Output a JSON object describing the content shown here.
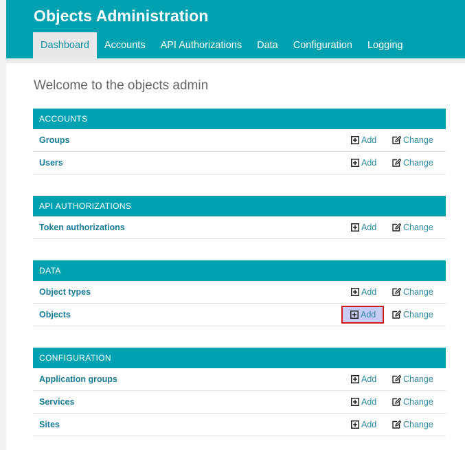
{
  "header": {
    "title": "Objects Administration",
    "nav": [
      {
        "label": "Dashboard",
        "active": true
      },
      {
        "label": "Accounts",
        "active": false
      },
      {
        "label": "API Authorizations",
        "active": false
      },
      {
        "label": "Data",
        "active": false
      },
      {
        "label": "Configuration",
        "active": false
      },
      {
        "label": "Logging",
        "active": false
      }
    ]
  },
  "welcome": "Welcome to the objects admin",
  "actions": {
    "add_label": "Add",
    "change_label": "Change"
  },
  "modules": [
    {
      "title": "ACCOUNTS",
      "rows": [
        {
          "name": "Groups"
        },
        {
          "name": "Users"
        }
      ]
    },
    {
      "title": "API AUTHORIZATIONS",
      "rows": [
        {
          "name": "Token authorizations"
        }
      ]
    },
    {
      "title": "DATA",
      "rows": [
        {
          "name": "Object types"
        },
        {
          "name": "Objects",
          "add_highlighted": true
        }
      ]
    },
    {
      "title": "CONFIGURATION",
      "rows": [
        {
          "name": "Application groups"
        },
        {
          "name": "Services"
        },
        {
          "name": "Sites"
        }
      ]
    }
  ],
  "colors": {
    "header": "#00a1b1",
    "link": "#1a7b98",
    "highlight_border": "#d11a1a",
    "highlight_fill": "#c7ccf5"
  },
  "icons": {
    "add": "plus-square-icon",
    "change": "edit-icon"
  }
}
